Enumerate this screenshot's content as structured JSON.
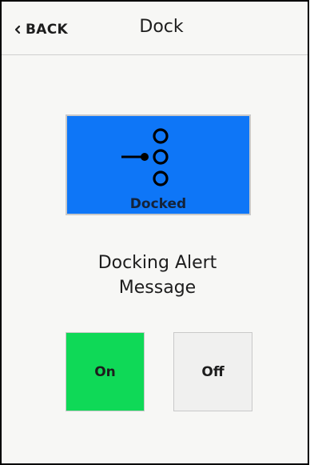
{
  "header": {
    "back_label": "BACK",
    "title": "Dock"
  },
  "dock_tile": {
    "status_label": "Docked",
    "icon": "dock-connection-icon",
    "color": "#0e76f7"
  },
  "alert": {
    "line1": "Docking Alert",
    "line2": "Message"
  },
  "toggle": {
    "on_label": "On",
    "off_label": "Off",
    "selected": "On",
    "on_color": "#0fd957",
    "off_color": "#f0f0ef"
  }
}
